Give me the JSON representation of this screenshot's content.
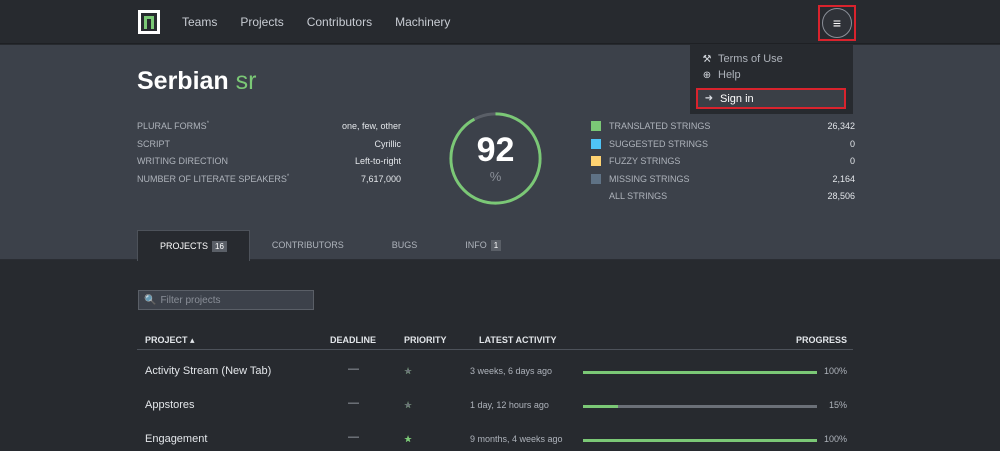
{
  "nav": {
    "links": [
      "Teams",
      "Projects",
      "Contributors",
      "Machinery"
    ],
    "menu_icon": "≡"
  },
  "dropdown": {
    "terms": "Terms of Use",
    "help": "Help",
    "signin": "Sign in"
  },
  "locale": {
    "name": "Serbian",
    "code": "sr"
  },
  "meta": [
    {
      "label": "PLURAL FORMS",
      "sup": "*",
      "value": "one, few, other"
    },
    {
      "label": "SCRIPT",
      "sup": "",
      "value": "Cyrillic"
    },
    {
      "label": "WRITING DIRECTION",
      "sup": "",
      "value": "Left-to-right"
    },
    {
      "label": "NUMBER OF LITERATE SPEAKERS",
      "sup": "*",
      "value": "7,617,000"
    }
  ],
  "completion": {
    "value": "92",
    "unit": "%",
    "fraction": 0.92
  },
  "stats": [
    {
      "label": "TRANSLATED STRINGS",
      "value": "26,342",
      "color": "#7bc876"
    },
    {
      "label": "SUGGESTED STRINGS",
      "value": "0",
      "color": "#4fc4f6"
    },
    {
      "label": "FUZZY STRINGS",
      "value": "0",
      "color": "#fed271"
    },
    {
      "label": "MISSING STRINGS",
      "value": "2,164",
      "color": "#5f7285"
    },
    {
      "label": "ALL STRINGS",
      "value": "28,506",
      "color": ""
    }
  ],
  "tabs": [
    {
      "label": "PROJECTS",
      "badge": "16"
    },
    {
      "label": "CONTRIBUTORS",
      "badge": ""
    },
    {
      "label": "BUGS",
      "badge": ""
    },
    {
      "label": "INFO",
      "badge": "1"
    }
  ],
  "filter": {
    "placeholder": "Filter projects"
  },
  "table": {
    "headers": {
      "project": "PROJECT ▴",
      "deadline": "DEADLINE",
      "priority": "PRIORITY",
      "activity": "LATEST ACTIVITY",
      "progress": "PROGRESS"
    },
    "rows": [
      {
        "project": "Activity Stream (New Tab)",
        "deadline": "—",
        "stars": 4,
        "activity": "3 weeks, 6 days ago",
        "progress": 1.0,
        "pct": "100%"
      },
      {
        "project": "Appstores",
        "deadline": "—",
        "stars": 4,
        "activity": "1 day, 12 hours ago",
        "progress": 0.15,
        "pct": "15%"
      },
      {
        "project": "Engagement",
        "deadline": "—",
        "stars": 5,
        "activity": "9 months, 4 weeks ago",
        "progress": 1.0,
        "pct": "100%"
      }
    ]
  }
}
